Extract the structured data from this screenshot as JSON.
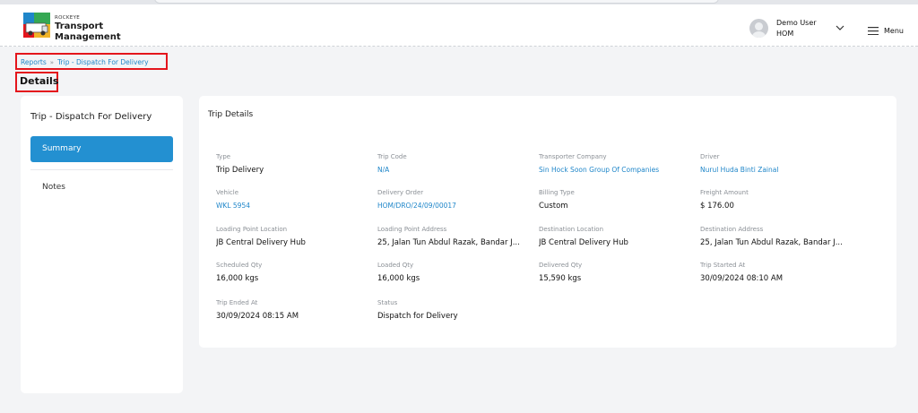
{
  "brand": {
    "top": "ROCKEYE",
    "line1": "Transport",
    "line2": "Management"
  },
  "user": {
    "name": "Demo User",
    "branch": "HOM"
  },
  "menu": {
    "label": "Menu"
  },
  "breadcrumb": {
    "root": "Reports",
    "sep": "»",
    "current": "Trip - Dispatch For Delivery"
  },
  "page": {
    "title": "Details"
  },
  "sidebar": {
    "title": "Trip - Dispatch For Delivery",
    "summary": "Summary",
    "notes": "Notes"
  },
  "trip": {
    "title": "Trip Details",
    "fields": [
      {
        "label": "Type",
        "value": "Trip Delivery",
        "link": false
      },
      {
        "label": "Trip Code",
        "value": "N/A",
        "link": true
      },
      {
        "label": "Transporter Company",
        "value": "Sin Hock Soon Group Of Companies",
        "link": true
      },
      {
        "label": "Driver",
        "value": "Nurul Huda Binti Zainal",
        "link": true
      },
      {
        "label": "Vehicle",
        "value": "WKL 5954",
        "link": true
      },
      {
        "label": "Delivery Order",
        "value": "HOM/DRO/24/09/00017",
        "link": true
      },
      {
        "label": "Billing Type",
        "value": "Custom",
        "link": false
      },
      {
        "label": "Freight Amount",
        "value": "$ 176.00",
        "link": false
      },
      {
        "label": "Loading Point Location",
        "value": "JB Central Delivery Hub",
        "link": false
      },
      {
        "label": "Loading Point Address",
        "value": "25, Jalan Tun Abdul Razak, Bandar J...",
        "link": false
      },
      {
        "label": "Destination Location",
        "value": "JB Central Delivery Hub",
        "link": false
      },
      {
        "label": "Destination Address",
        "value": "25, Jalan Tun Abdul Razak, Bandar J...",
        "link": false
      },
      {
        "label": "Scheduled Qty",
        "value": "16,000 kgs",
        "link": false
      },
      {
        "label": "Loaded Qty",
        "value": "16,000 kgs",
        "link": false
      },
      {
        "label": "Delivered Qty",
        "value": "15,590 kgs",
        "link": false
      },
      {
        "label": "Trip Started At",
        "value": "30/09/2024 08:10 AM",
        "link": false
      },
      {
        "label": "Trip Ended At",
        "value": "30/09/2024 08:15 AM",
        "link": false
      },
      {
        "label": "Status",
        "value": "Dispatch for Delivery",
        "link": false
      }
    ]
  },
  "colors": {
    "accent": "#2390d1",
    "link": "#1f86c9",
    "highlight": "#e4151c"
  }
}
